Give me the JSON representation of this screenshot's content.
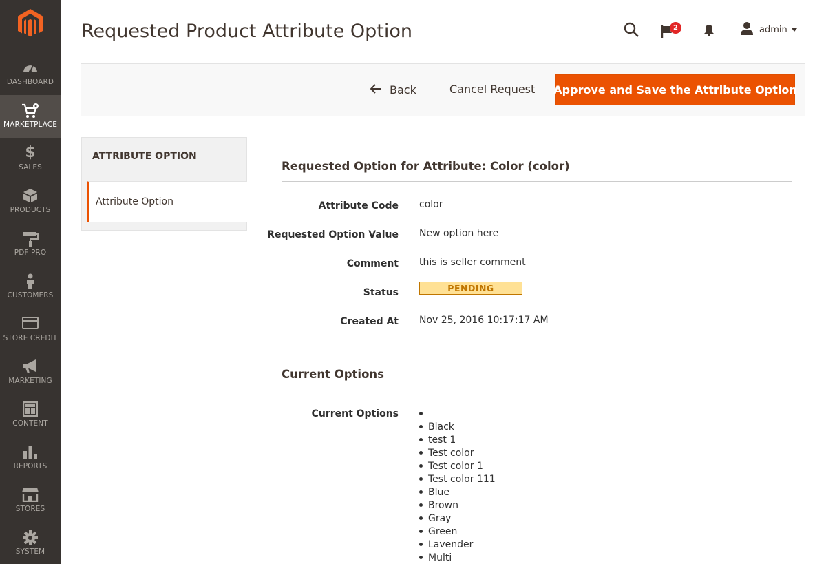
{
  "sidebar": {
    "items": [
      {
        "label": "DASHBOARD",
        "icon": "dashboard-icon"
      },
      {
        "label": "MARKETPLACE",
        "icon": "cart-gear-icon",
        "active": true
      },
      {
        "label": "SALES",
        "icon": "dollar-icon"
      },
      {
        "label": "PRODUCTS",
        "icon": "box-icon"
      },
      {
        "label": "PDF PRO",
        "icon": "paint-roller-icon"
      },
      {
        "label": "CUSTOMERS",
        "icon": "person-icon"
      },
      {
        "label": "STORE CREDIT",
        "icon": "credit-card-icon"
      },
      {
        "label": "MARKETING",
        "icon": "megaphone-icon"
      },
      {
        "label": "CONTENT",
        "icon": "layout-icon"
      },
      {
        "label": "REPORTS",
        "icon": "bar-chart-icon"
      },
      {
        "label": "STORES",
        "icon": "storefront-icon"
      },
      {
        "label": "SYSTEM",
        "icon": "gear-icon"
      }
    ]
  },
  "header": {
    "title": "Requested Product Attribute Option",
    "notification_count": "2",
    "user_name": "admin"
  },
  "actions": {
    "back_label": "Back",
    "cancel_label": "Cancel Request",
    "approve_label": "Approve and Save the Attribute Option"
  },
  "tabs": {
    "title": "ATTRIBUTE OPTION",
    "items": [
      {
        "label": "Attribute Option",
        "active": true
      }
    ]
  },
  "requested": {
    "section_title": "Requested Option for Attribute: Color (color)",
    "fields": [
      {
        "label": "Attribute Code",
        "value": "color"
      },
      {
        "label": "Requested Option Value",
        "value": "New option here"
      },
      {
        "label": "Comment",
        "value": "this is seller comment"
      },
      {
        "label": "Status",
        "value": "PENDING"
      },
      {
        "label": "Created At",
        "value": "Nov 25, 2016 10:17:17 AM"
      }
    ]
  },
  "current": {
    "section_title": "Current Options",
    "label": "Current Options",
    "options": [
      "",
      "Black",
      "test 1",
      "Test color",
      "Test color 1",
      "Test color 111",
      "Blue",
      "Brown",
      "Gray",
      "Green",
      "Lavender",
      "Multi"
    ]
  },
  "colors": {
    "sidebar_bg": "#373330",
    "sidebar_active": "#524d49",
    "accent": "#eb5202",
    "badge_red": "#e22626",
    "pending_bg": "#ffe195",
    "pending_text": "#c07600"
  }
}
